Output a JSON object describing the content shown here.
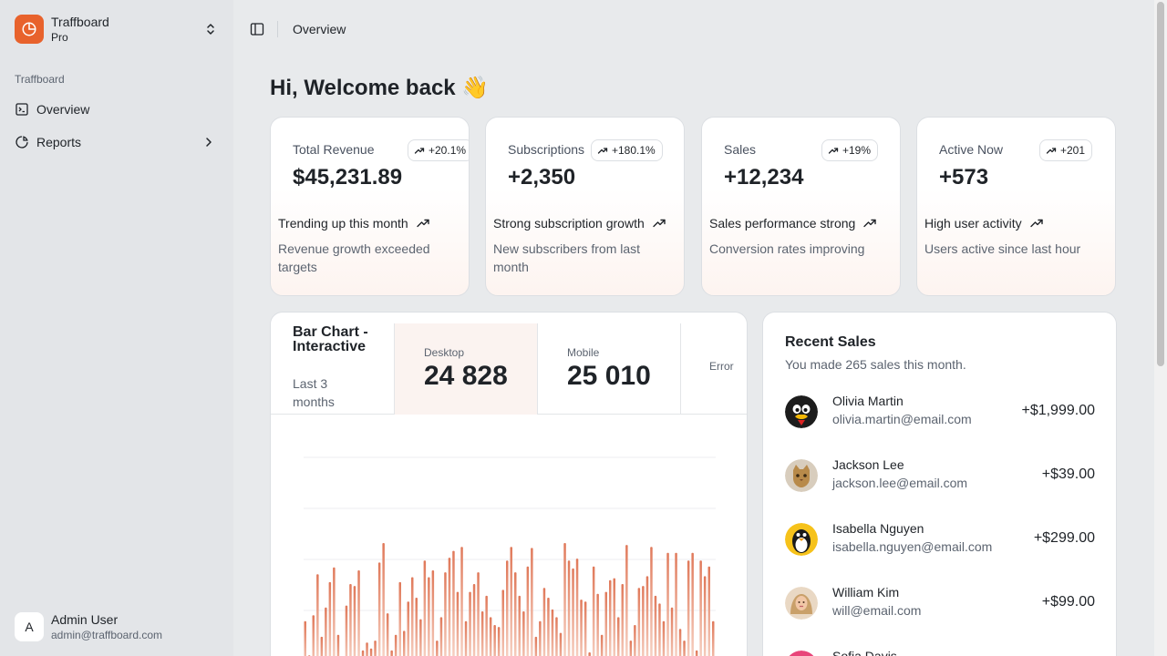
{
  "app": {
    "name": "Traffboard",
    "plan": "Pro"
  },
  "sidebar": {
    "group_label": "Traffboard",
    "items": [
      {
        "label": "Overview",
        "icon": "dashboard-icon"
      },
      {
        "label": "Reports",
        "icon": "pie-chart-icon"
      }
    ],
    "user": {
      "initial": "A",
      "name": "Admin User",
      "email": "admin@traffboard.com"
    }
  },
  "header": {
    "breadcrumb": "Overview"
  },
  "greeting": "Hi, Welcome back 👋",
  "stats": [
    {
      "label": "Total Revenue",
      "badge": "+20.1%",
      "value": "$45,231.89",
      "trend": "Trending up this month",
      "desc": "Revenue growth exceeded targets"
    },
    {
      "label": "Subscriptions",
      "badge": "+180.1%",
      "value": "+2,350",
      "trend": "Strong subscription growth",
      "desc": "New subscribers from last month"
    },
    {
      "label": "Sales",
      "badge": "+19%",
      "value": "+12,234",
      "trend": "Sales performance strong",
      "desc": "Conversion rates improving"
    },
    {
      "label": "Active Now",
      "badge": "+201",
      "value": "+573",
      "trend": "High user activity",
      "desc": "Users active since last hour"
    }
  ],
  "chart_card": {
    "title": "Bar Chart - Interactive",
    "subtitle": "Last 3 months",
    "tabs": [
      {
        "label": "Desktop",
        "value": "24 828"
      },
      {
        "label": "Mobile",
        "value": "25 010"
      },
      {
        "label": "Error",
        "value": ""
      }
    ]
  },
  "chart_data": {
    "type": "bar",
    "series": [
      {
        "values": [
          60,
          25,
          66,
          108,
          44,
          74,
          100,
          115,
          46,
          23,
          76,
          98,
          96,
          112,
          30,
          38,
          32,
          40,
          120,
          140,
          68,
          30,
          46,
          100,
          50,
          80,
          105,
          84,
          62,
          122,
          105,
          112,
          40,
          64,
          110,
          125,
          132,
          90,
          136,
          60,
          90,
          98,
          110,
          70,
          86,
          64,
          56,
          54,
          92,
          122,
          136,
          110,
          86,
          70,
          116,
          135,
          44,
          60,
          94,
          84,
          72,
          64,
          48,
          140,
          122,
          114,
          124,
          82,
          80,
          28,
          116,
          88,
          46,
          90,
          102,
          104,
          64,
          98,
          138,
          40,
          56,
          94,
          96,
          106,
          136,
          86,
          78,
          60,
          130,
          74,
          130,
          52,
          40,
          122,
          130,
          30,
          122,
          106,
          116,
          60
        ]
      }
    ],
    "colors": {
      "bar_top": "#e0795a",
      "bar_bottom": "#fbe3d8"
    },
    "grid": true
  },
  "recent_sales": {
    "title": "Recent Sales",
    "subtitle": "You made 265 sales this month.",
    "items": [
      {
        "name": "Olivia Martin",
        "email": "olivia.martin@email.com",
        "amount": "+$1,999.00",
        "avatar": "penguin-avatar"
      },
      {
        "name": "Jackson Lee",
        "email": "jackson.lee@email.com",
        "amount": "+$39.00",
        "avatar": "cat-avatar"
      },
      {
        "name": "Isabella Nguyen",
        "email": "isabella.nguyen@email.com",
        "amount": "+$299.00",
        "avatar": "penguin-yellow-avatar"
      },
      {
        "name": "William Kim",
        "email": "will@email.com",
        "amount": "+$99.00",
        "avatar": "portrait-avatar"
      },
      {
        "name": "Sofia Davis",
        "email": "",
        "amount": "",
        "avatar": "pink-avatar"
      }
    ]
  },
  "colors": {
    "accent": "#e8622c",
    "sidebar_bg": "#e3e5e8",
    "page_bg": "#e8eaec"
  }
}
